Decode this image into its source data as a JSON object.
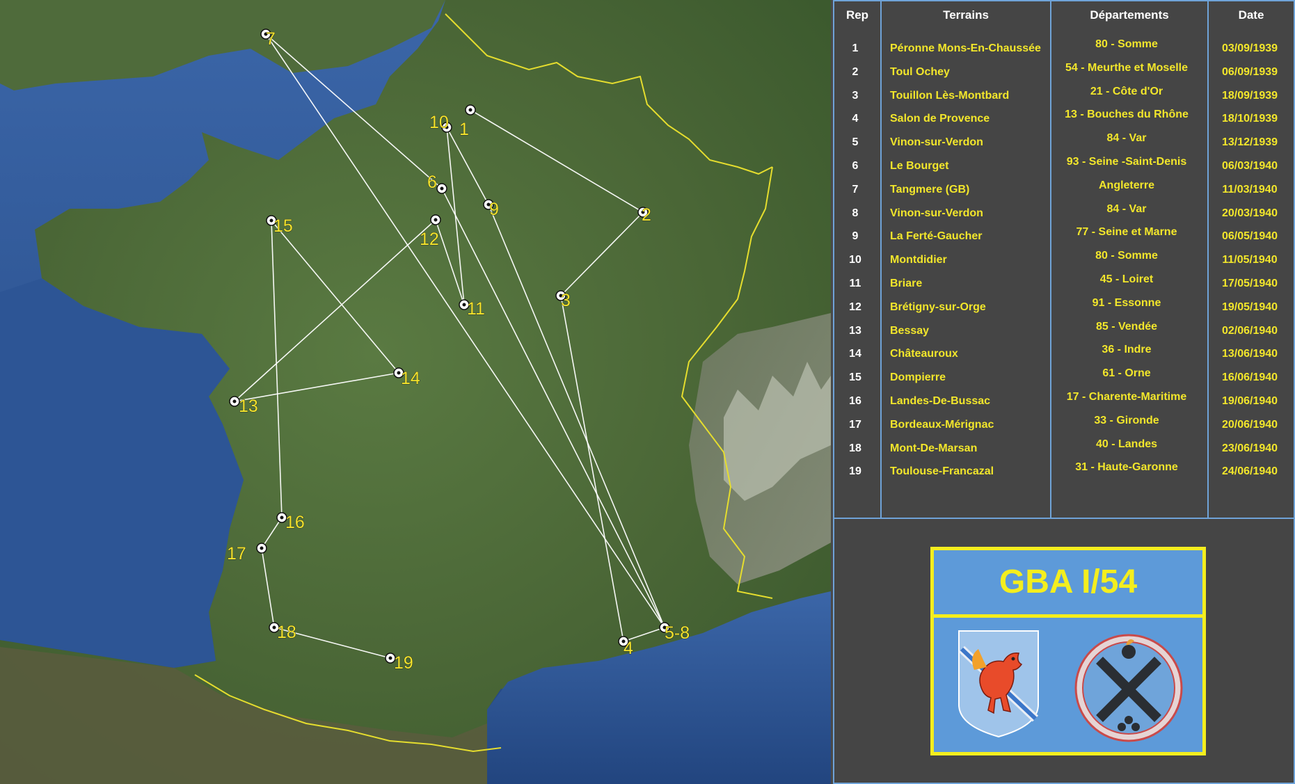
{
  "table": {
    "headers": {
      "rep": "Rep",
      "terrains": "Terrains",
      "departements": "Départements",
      "date": "Date"
    },
    "rows": [
      {
        "rep": "1",
        "terrain": "Péronne Mons-En-Chaussée",
        "departement": "80 - Somme",
        "date": "03/09/1939"
      },
      {
        "rep": "2",
        "terrain": "Toul Ochey",
        "departement": "54 - Meurthe et Moselle",
        "date": "06/09/1939"
      },
      {
        "rep": "3",
        "terrain": "Touillon Lès-Montbard",
        "departement": "21 - Côte d'Or",
        "date": "18/09/1939"
      },
      {
        "rep": "4",
        "terrain": "Salon de Provence",
        "departement": "13 - Bouches du Rhône",
        "date": "18/10/1939"
      },
      {
        "rep": "5",
        "terrain": "Vinon-sur-Verdon",
        "departement": "84 - Var",
        "date": "13/12/1939"
      },
      {
        "rep": "6",
        "terrain": "Le Bourget",
        "departement": "93 - Seine -Saint-Denis",
        "date": "06/03/1940"
      },
      {
        "rep": "7",
        "terrain": "Tangmere (GB)",
        "departement": "Angleterre",
        "date": "11/03/1940"
      },
      {
        "rep": "8",
        "terrain": "Vinon-sur-Verdon",
        "departement": "84 - Var",
        "date": "20/03/1940"
      },
      {
        "rep": "9",
        "terrain": "La Ferté-Gaucher",
        "departement": "77 - Seine et Marne",
        "date": "06/05/1940"
      },
      {
        "rep": "10",
        "terrain": "Montdidier",
        "departement": "80 - Somme",
        "date": "11/05/1940"
      },
      {
        "rep": "11",
        "terrain": "Briare",
        "departement": "45 - Loiret",
        "date": "17/05/1940"
      },
      {
        "rep": "12",
        "terrain": "Brétigny-sur-Orge",
        "departement": "91 - Essonne",
        "date": "19/05/1940"
      },
      {
        "rep": "13",
        "terrain": "Bessay",
        "departement": "85 - Vendée",
        "date": "02/06/1940"
      },
      {
        "rep": "14",
        "terrain": "Châteauroux",
        "departement": "36 - Indre",
        "date": "13/06/1940"
      },
      {
        "rep": "15",
        "terrain": "Dompierre",
        "departement": "61 - Orne",
        "date": "16/06/1940"
      },
      {
        "rep": "16",
        "terrain": "Landes-De-Bussac",
        "departement": "17 - Charente-Maritime",
        "date": "19/06/1940"
      },
      {
        "rep": "17",
        "terrain": "Bordeaux-Mérignac",
        "departement": "33 - Gironde",
        "date": "20/06/1940"
      },
      {
        "rep": "18",
        "terrain": "Mont-De-Marsan",
        "departement": "40 - Landes",
        "date": "23/06/1940"
      },
      {
        "rep": "19",
        "terrain": "Toulouse-Francazal",
        "departement": "31 - Haute-Garonne",
        "date": "24/06/1940"
      }
    ]
  },
  "badge": {
    "title": "GBA I/54"
  },
  "map": {
    "labels": [
      "1",
      "2",
      "3",
      "4",
      "5-8",
      "6",
      "7",
      "9",
      "10",
      "11",
      "12",
      "13",
      "14",
      "15",
      "16",
      "17",
      "18",
      "19"
    ]
  },
  "colors": {
    "panel_bg": "#454545",
    "border": "#6fa3d8",
    "label_yellow": "#f2e62b",
    "badge_blue": "#5d9ad9",
    "badge_yellow": "#f4ee1e",
    "route_white": "#ffffff",
    "sea": "#2a4f8f",
    "land": "#4d6b38",
    "border_yellow": "#e5dd2e"
  }
}
